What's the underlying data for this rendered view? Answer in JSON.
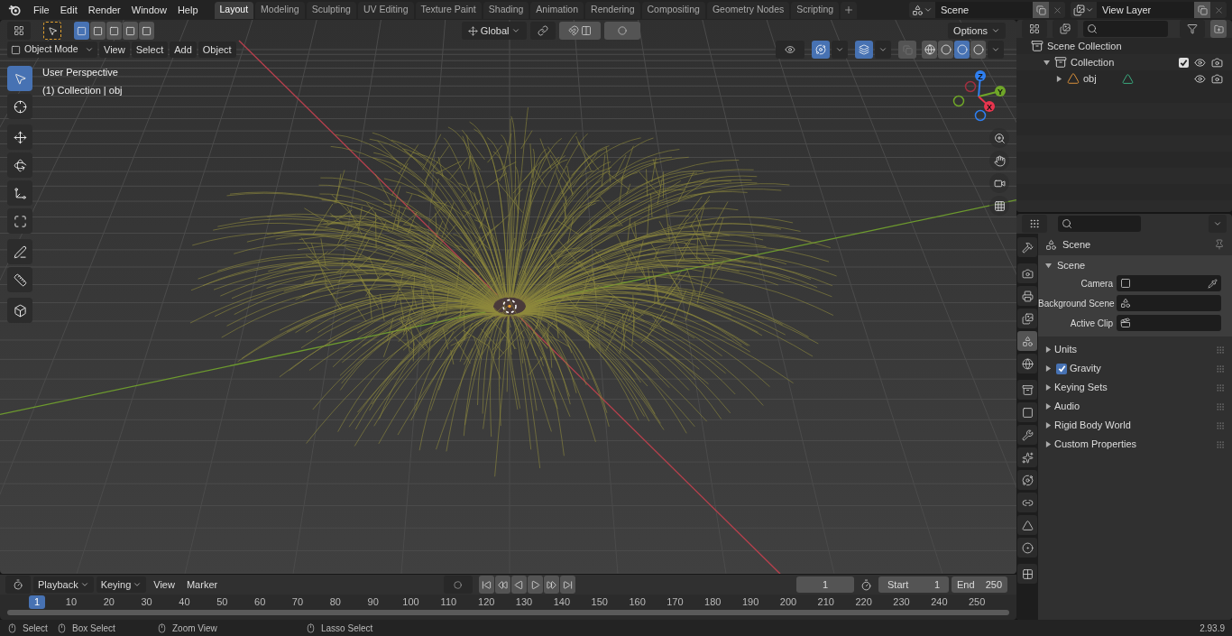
{
  "menu": [
    "File",
    "Edit",
    "Render",
    "Window",
    "Help"
  ],
  "workspaces": [
    {
      "label": "Layout",
      "selected": true
    },
    {
      "label": "Modeling",
      "selected": false
    },
    {
      "label": "Sculpting",
      "selected": false
    },
    {
      "label": "UV Editing",
      "selected": false
    },
    {
      "label": "Texture Paint",
      "selected": false
    },
    {
      "label": "Shading",
      "selected": false
    },
    {
      "label": "Animation",
      "selected": false
    },
    {
      "label": "Rendering",
      "selected": false
    },
    {
      "label": "Compositing",
      "selected": false
    },
    {
      "label": "Geometry Nodes",
      "selected": false
    },
    {
      "label": "Scripting",
      "selected": false
    }
  ],
  "scene_field": {
    "value": "Scene"
  },
  "view_layer_field": {
    "value": "View Layer"
  },
  "viewport": {
    "select_modes": [
      {
        "selected": true
      },
      {
        "selected": false
      },
      {
        "selected": false
      },
      {
        "selected": false
      },
      {
        "selected": false
      }
    ],
    "orientation": "Global",
    "toggles": {
      "snap": false,
      "proportional_edit": false,
      "gizmos": true,
      "overlays": true,
      "xray": false
    },
    "options": "Options",
    "mode": "Object Mode",
    "menus": [
      "View",
      "Select",
      "Add",
      "Object"
    ],
    "shading_modes": [
      {
        "selected": false
      },
      {
        "selected": false
      },
      {
        "selected": true
      },
      {
        "selected": false
      }
    ],
    "overlay_text": [
      "User Perspective",
      "(1) Collection | obj"
    ],
    "tool_groups": [
      [
        {
          "selected": true
        },
        {
          "selected": false
        }
      ],
      [
        {
          "selected": false
        },
        {
          "selected": false
        },
        {
          "selected": false
        },
        {
          "selected": false
        }
      ],
      [
        {
          "selected": false
        },
        {
          "selected": false
        }
      ],
      [
        {
          "selected": false
        }
      ]
    ],
    "gizmo_axes": [
      {
        "label": "Z",
        "color": "#2f7ff0"
      },
      {
        "label": "Y",
        "color": "#6fa628"
      },
      {
        "label": "X",
        "color": "#e8354e"
      }
    ]
  },
  "outliner": {
    "items": [
      {
        "label": "Scene Collection",
        "children": [
          {
            "label": "Collection",
            "expanded": true,
            "checked": true,
            "children": [
              {
                "label": "obj",
                "expanded": false
              }
            ]
          }
        ]
      }
    ]
  },
  "properties": {
    "tabs": [
      {
        "selected": false
      },
      {
        "selected": false
      },
      {
        "selected": false
      },
      {
        "selected": false
      },
      {
        "selected": true
      },
      {
        "selected": false
      },
      {
        "selected": false
      },
      {
        "selected": false
      },
      {
        "selected": false
      },
      {
        "selected": false
      },
      {
        "selected": false
      },
      {
        "selected": false
      },
      {
        "selected": false
      },
      {
        "selected": false
      },
      {
        "selected": false
      }
    ],
    "context": "Scene",
    "panel": {
      "title": "Scene",
      "expanded": true,
      "fields": [
        {
          "kind": "camera",
          "label": "Camera"
        },
        {
          "kind": "scene",
          "label": "Background Scene"
        },
        {
          "kind": "clip",
          "label": "Active Clip"
        }
      ]
    },
    "sections": [
      {
        "kind": "plain",
        "label": "Units"
      },
      {
        "kind": "checkbox",
        "label": "Gravity",
        "checked": true
      },
      {
        "kind": "plain",
        "label": "Keying Sets"
      },
      {
        "kind": "plain",
        "label": "Audio"
      },
      {
        "kind": "plain",
        "label": "Rigid Body World"
      },
      {
        "kind": "plain",
        "label": "Custom Properties"
      }
    ]
  },
  "timeline": {
    "menus": [
      {
        "label": "Playback",
        "dropdown": true
      },
      {
        "label": "Keying",
        "dropdown": true
      },
      {
        "label": "View",
        "dropdown": false
      },
      {
        "label": "Marker",
        "dropdown": false
      }
    ],
    "current_frame": "1",
    "start_label": "Start",
    "start": "1",
    "end_label": "End",
    "end": "250",
    "frame_marker": "1",
    "ruler": [
      "10",
      "20",
      "30",
      "40",
      "50",
      "60",
      "70",
      "80",
      "90",
      "100",
      "110",
      "120",
      "130",
      "140",
      "150",
      "160",
      "170",
      "180",
      "190",
      "200",
      "210",
      "220",
      "230",
      "240",
      "250"
    ]
  },
  "status_bar": {
    "hints": [
      "Select",
      "Box Select",
      "Zoom View",
      "Lasso Select"
    ],
    "version": "2.93.9"
  }
}
